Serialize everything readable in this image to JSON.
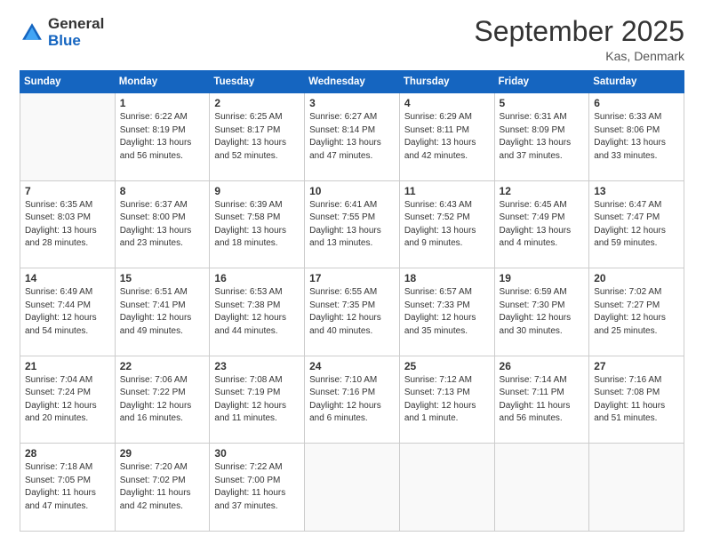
{
  "logo": {
    "general": "General",
    "blue": "Blue"
  },
  "header": {
    "title": "September 2025",
    "location": "Kas, Denmark"
  },
  "days_of_week": [
    "Sunday",
    "Monday",
    "Tuesday",
    "Wednesday",
    "Thursday",
    "Friday",
    "Saturday"
  ],
  "weeks": [
    [
      {
        "day": "",
        "sunrise": "",
        "sunset": "",
        "daylight": ""
      },
      {
        "day": "1",
        "sunrise": "Sunrise: 6:22 AM",
        "sunset": "Sunset: 8:19 PM",
        "daylight": "Daylight: 13 hours and 56 minutes."
      },
      {
        "day": "2",
        "sunrise": "Sunrise: 6:25 AM",
        "sunset": "Sunset: 8:17 PM",
        "daylight": "Daylight: 13 hours and 52 minutes."
      },
      {
        "day": "3",
        "sunrise": "Sunrise: 6:27 AM",
        "sunset": "Sunset: 8:14 PM",
        "daylight": "Daylight: 13 hours and 47 minutes."
      },
      {
        "day": "4",
        "sunrise": "Sunrise: 6:29 AM",
        "sunset": "Sunset: 8:11 PM",
        "daylight": "Daylight: 13 hours and 42 minutes."
      },
      {
        "day": "5",
        "sunrise": "Sunrise: 6:31 AM",
        "sunset": "Sunset: 8:09 PM",
        "daylight": "Daylight: 13 hours and 37 minutes."
      },
      {
        "day": "6",
        "sunrise": "Sunrise: 6:33 AM",
        "sunset": "Sunset: 8:06 PM",
        "daylight": "Daylight: 13 hours and 33 minutes."
      }
    ],
    [
      {
        "day": "7",
        "sunrise": "Sunrise: 6:35 AM",
        "sunset": "Sunset: 8:03 PM",
        "daylight": "Daylight: 13 hours and 28 minutes."
      },
      {
        "day": "8",
        "sunrise": "Sunrise: 6:37 AM",
        "sunset": "Sunset: 8:00 PM",
        "daylight": "Daylight: 13 hours and 23 minutes."
      },
      {
        "day": "9",
        "sunrise": "Sunrise: 6:39 AM",
        "sunset": "Sunset: 7:58 PM",
        "daylight": "Daylight: 13 hours and 18 minutes."
      },
      {
        "day": "10",
        "sunrise": "Sunrise: 6:41 AM",
        "sunset": "Sunset: 7:55 PM",
        "daylight": "Daylight: 13 hours and 13 minutes."
      },
      {
        "day": "11",
        "sunrise": "Sunrise: 6:43 AM",
        "sunset": "Sunset: 7:52 PM",
        "daylight": "Daylight: 13 hours and 9 minutes."
      },
      {
        "day": "12",
        "sunrise": "Sunrise: 6:45 AM",
        "sunset": "Sunset: 7:49 PM",
        "daylight": "Daylight: 13 hours and 4 minutes."
      },
      {
        "day": "13",
        "sunrise": "Sunrise: 6:47 AM",
        "sunset": "Sunset: 7:47 PM",
        "daylight": "Daylight: 12 hours and 59 minutes."
      }
    ],
    [
      {
        "day": "14",
        "sunrise": "Sunrise: 6:49 AM",
        "sunset": "Sunset: 7:44 PM",
        "daylight": "Daylight: 12 hours and 54 minutes."
      },
      {
        "day": "15",
        "sunrise": "Sunrise: 6:51 AM",
        "sunset": "Sunset: 7:41 PM",
        "daylight": "Daylight: 12 hours and 49 minutes."
      },
      {
        "day": "16",
        "sunrise": "Sunrise: 6:53 AM",
        "sunset": "Sunset: 7:38 PM",
        "daylight": "Daylight: 12 hours and 44 minutes."
      },
      {
        "day": "17",
        "sunrise": "Sunrise: 6:55 AM",
        "sunset": "Sunset: 7:35 PM",
        "daylight": "Daylight: 12 hours and 40 minutes."
      },
      {
        "day": "18",
        "sunrise": "Sunrise: 6:57 AM",
        "sunset": "Sunset: 7:33 PM",
        "daylight": "Daylight: 12 hours and 35 minutes."
      },
      {
        "day": "19",
        "sunrise": "Sunrise: 6:59 AM",
        "sunset": "Sunset: 7:30 PM",
        "daylight": "Daylight: 12 hours and 30 minutes."
      },
      {
        "day": "20",
        "sunrise": "Sunrise: 7:02 AM",
        "sunset": "Sunset: 7:27 PM",
        "daylight": "Daylight: 12 hours and 25 minutes."
      }
    ],
    [
      {
        "day": "21",
        "sunrise": "Sunrise: 7:04 AM",
        "sunset": "Sunset: 7:24 PM",
        "daylight": "Daylight: 12 hours and 20 minutes."
      },
      {
        "day": "22",
        "sunrise": "Sunrise: 7:06 AM",
        "sunset": "Sunset: 7:22 PM",
        "daylight": "Daylight: 12 hours and 16 minutes."
      },
      {
        "day": "23",
        "sunrise": "Sunrise: 7:08 AM",
        "sunset": "Sunset: 7:19 PM",
        "daylight": "Daylight: 12 hours and 11 minutes."
      },
      {
        "day": "24",
        "sunrise": "Sunrise: 7:10 AM",
        "sunset": "Sunset: 7:16 PM",
        "daylight": "Daylight: 12 hours and 6 minutes."
      },
      {
        "day": "25",
        "sunrise": "Sunrise: 7:12 AM",
        "sunset": "Sunset: 7:13 PM",
        "daylight": "Daylight: 12 hours and 1 minute."
      },
      {
        "day": "26",
        "sunrise": "Sunrise: 7:14 AM",
        "sunset": "Sunset: 7:11 PM",
        "daylight": "Daylight: 11 hours and 56 minutes."
      },
      {
        "day": "27",
        "sunrise": "Sunrise: 7:16 AM",
        "sunset": "Sunset: 7:08 PM",
        "daylight": "Daylight: 11 hours and 51 minutes."
      }
    ],
    [
      {
        "day": "28",
        "sunrise": "Sunrise: 7:18 AM",
        "sunset": "Sunset: 7:05 PM",
        "daylight": "Daylight: 11 hours and 47 minutes."
      },
      {
        "day": "29",
        "sunrise": "Sunrise: 7:20 AM",
        "sunset": "Sunset: 7:02 PM",
        "daylight": "Daylight: 11 hours and 42 minutes."
      },
      {
        "day": "30",
        "sunrise": "Sunrise: 7:22 AM",
        "sunset": "Sunset: 7:00 PM",
        "daylight": "Daylight: 11 hours and 37 minutes."
      },
      {
        "day": "",
        "sunrise": "",
        "sunset": "",
        "daylight": ""
      },
      {
        "day": "",
        "sunrise": "",
        "sunset": "",
        "daylight": ""
      },
      {
        "day": "",
        "sunrise": "",
        "sunset": "",
        "daylight": ""
      },
      {
        "day": "",
        "sunrise": "",
        "sunset": "",
        "daylight": ""
      }
    ]
  ]
}
